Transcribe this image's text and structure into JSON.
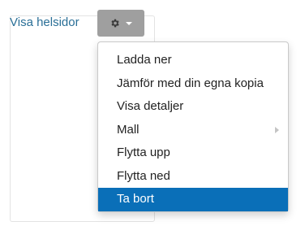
{
  "view_link": {
    "label": "Visa helsidor"
  },
  "actions_button": {
    "icon": "gear-icon",
    "caret_icon": "caret-down-icon",
    "color": "#9f9f9f"
  },
  "menu": {
    "items": [
      {
        "label": "Ladda ner"
      },
      {
        "label": "Jämför med din egna kopia"
      },
      {
        "label": "Visa detaljer"
      },
      {
        "label": "Mall",
        "has_submenu": true
      },
      {
        "label": "Flytta upp"
      },
      {
        "label": "Flytta ned"
      },
      {
        "label": "Ta bort",
        "highlighted": true
      }
    ],
    "highlight_color": "#0a6fb8"
  }
}
